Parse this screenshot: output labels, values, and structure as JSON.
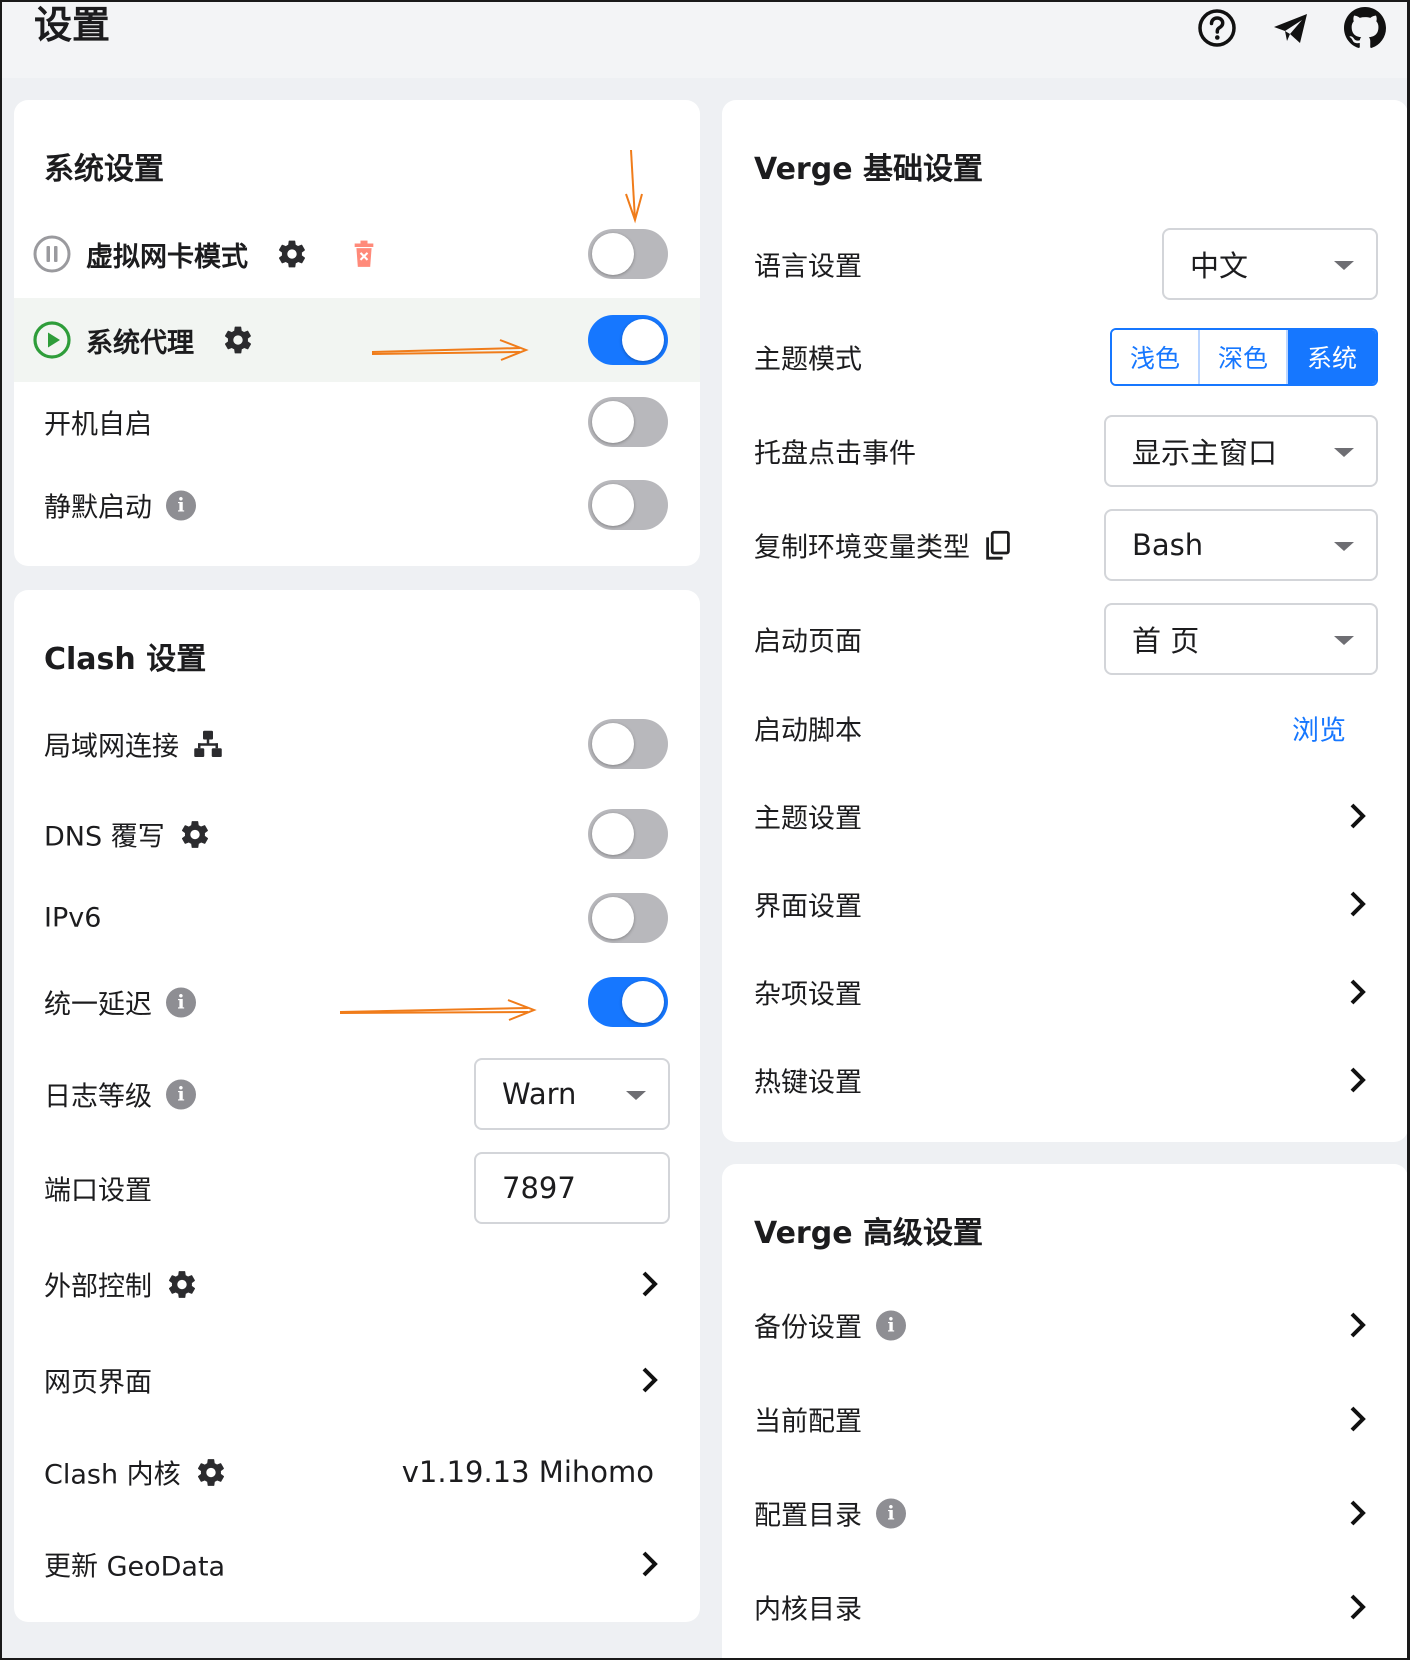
{
  "page": {
    "title": "设置"
  },
  "topbar": {
    "icons": [
      "help-icon",
      "telegram-icon",
      "github-icon"
    ]
  },
  "system_settings": {
    "title": "系统设置",
    "tun_mode": {
      "label": "虚拟网卡模式",
      "enabled": false
    },
    "system_proxy": {
      "label": "系统代理",
      "enabled": true
    },
    "auto_launch": {
      "label": "开机自启",
      "enabled": false
    },
    "silent_start": {
      "label": "静默启动",
      "enabled": false
    }
  },
  "clash_settings": {
    "title": "Clash 设置",
    "allow_lan": {
      "label": "局域网连接",
      "enabled": false
    },
    "dns_override": {
      "label": "DNS 覆写",
      "enabled": false
    },
    "ipv6": {
      "label": "IPv6",
      "enabled": false
    },
    "unified_delay": {
      "label": "统一延迟",
      "enabled": true
    },
    "log_level": {
      "label": "日志等级",
      "value": "Warn"
    },
    "port": {
      "label": "端口设置",
      "value": "7897"
    },
    "external_control": {
      "label": "外部控制"
    },
    "web_ui": {
      "label": "网页界面"
    },
    "core": {
      "label": "Clash 内核",
      "value": "v1.19.13 Mihomo"
    },
    "update_geodata": {
      "label": "更新 GeoData"
    }
  },
  "verge_basic": {
    "title": "Verge 基础设置",
    "language": {
      "label": "语言设置",
      "value": "中文"
    },
    "theme_mode": {
      "label": "主题模式",
      "options": [
        "浅色",
        "深色",
        "系统"
      ],
      "selected": "系统"
    },
    "tray_click": {
      "label": "托盘点击事件",
      "value": "显示主窗口"
    },
    "copy_env": {
      "label": "复制环境变量类型",
      "value": "Bash"
    },
    "start_page": {
      "label": "启动页面",
      "value": "首 页"
    },
    "startup_script": {
      "label": "启动脚本",
      "action": "浏览"
    },
    "theme_settings": {
      "label": "主题设置"
    },
    "layout_settings": {
      "label": "界面设置"
    },
    "misc_settings": {
      "label": "杂项设置"
    },
    "hotkey_settings": {
      "label": "热键设置"
    }
  },
  "verge_advanced": {
    "title": "Verge 高级设置",
    "backup": {
      "label": "备份设置"
    },
    "current_config": {
      "label": "当前配置"
    },
    "config_dir": {
      "label": "配置目录"
    },
    "core_dir": {
      "label": "内核目录"
    }
  },
  "colors": {
    "accent": "#1677ff",
    "annotation": "#f07c1a",
    "running": "#2e9d3a",
    "delete": "#ff6b5b"
  }
}
